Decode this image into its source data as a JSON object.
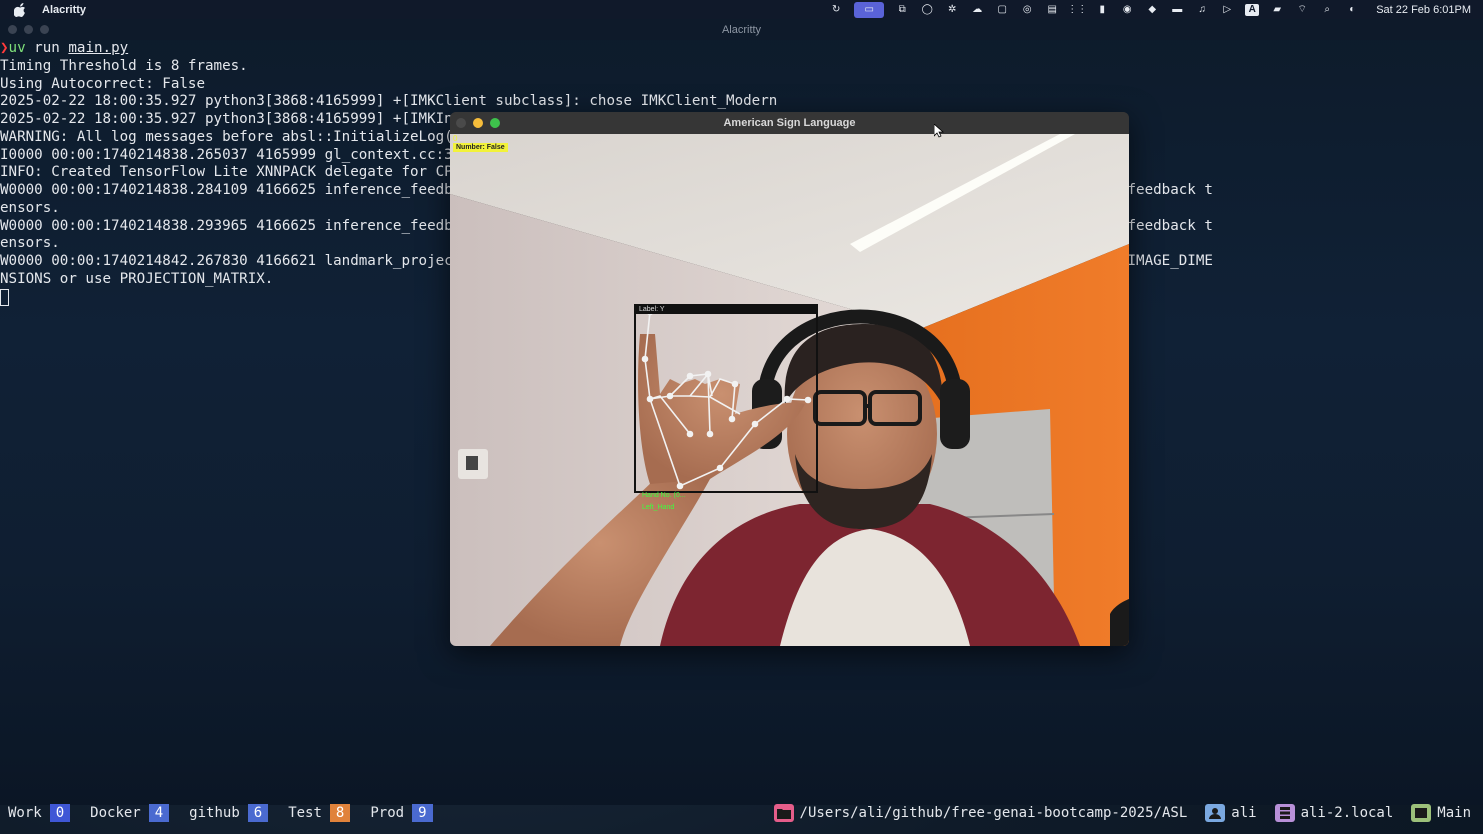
{
  "menubar": {
    "app_name": "Alacritty",
    "datetime": "Sat 22 Feb  6:01PM",
    "icons": [
      "sync-icon",
      "screen-mirror-icon",
      "cast-icon",
      "cloud-icon",
      "gear-icon",
      "weather-icon",
      "display-icon",
      "vpn-icon",
      "clipboard-icon",
      "grid-icon",
      "battery-widget-icon",
      "record-icon",
      "diamond-icon",
      "keyboard-icon",
      "headphones-icon",
      "play-icon",
      "input-source-icon",
      "battery-icon",
      "wifi-icon",
      "search-icon",
      "control-center-icon"
    ],
    "input_source_label": "A"
  },
  "terminal": {
    "title": "Alacritty",
    "lines": [
      {
        "type": "prompt",
        "arrow": "❯",
        "cmd": "uv",
        "args": " run ",
        "file": "main.py"
      },
      {
        "type": "text",
        "text": "Timing Threshold is 8 frames."
      },
      {
        "type": "text",
        "text": "Using Autocorrect: False"
      },
      {
        "type": "text",
        "text": "2025-02-22 18:00:35.927 python3[3868:4165999] +[IMKClient subclass]: chose IMKClient_Modern"
      },
      {
        "type": "text",
        "text": "2025-02-22 18:00:35.927 python3[3868:4165999] +[IMKIn"
      },
      {
        "type": "text",
        "text": "WARNING: All log messages before absl::InitializeLog("
      },
      {
        "type": "text",
        "text": "I0000 00:00:1740214838.265037 4165999 gl_context.cc:3"
      },
      {
        "type": "text",
        "text": "INFO: Created TensorFlow Lite XNNPACK delegate for CP"
      },
      {
        "type": "text",
        "text": "W0000 00:00:1740214838.284109 4166625 inference_feedb                                                ference. Disabling support for feedback t"
      },
      {
        "type": "text",
        "text": "ensors."
      },
      {
        "type": "text",
        "text": "W0000 00:00:1740214838.293965 4166625 inference_feedb                                                ference. Disabling support for feedback t"
      },
      {
        "type": "text",
        "text": "ensors."
      },
      {
        "type": "text",
        "text": "W0000 00:00:1740214842.267830 4166621 landmark_projec                                                ed for the square ROI. Provide IMAGE_DIME"
      },
      {
        "type": "text",
        "text": "NSIONS or use PROJECTION_MATRIX."
      },
      {
        "type": "cursor"
      }
    ]
  },
  "asl_window": {
    "title": "American Sign Language",
    "overlay": {
      "zero_text": "0",
      "number_badge": "Number: False",
      "hand_label": "Label: Y",
      "green_label_1": "Hand No. (0...",
      "green_label_2": "Left_Hand"
    }
  },
  "statusbar": {
    "workspaces": [
      {
        "name": "Work",
        "num": "0",
        "color": "#3f57d6"
      },
      {
        "name": "Docker",
        "num": "4",
        "color": "#4a6ad0"
      },
      {
        "name": "github",
        "num": "6",
        "color": "#4a6ad0"
      },
      {
        "name": "Test",
        "num": "8",
        "color": "#e0823b"
      },
      {
        "name": "Prod",
        "num": "9",
        "color": "#4a6ad0"
      }
    ],
    "path": "/Users/ali/github/free-genai-bootcamp-2025/ASL",
    "user": "ali",
    "host": "ali-2.local",
    "session": "Main",
    "colors": {
      "folder": "#e55d8a",
      "user": "#7aa8e0",
      "host": "#b890d8",
      "session": "#9cc07a"
    }
  }
}
